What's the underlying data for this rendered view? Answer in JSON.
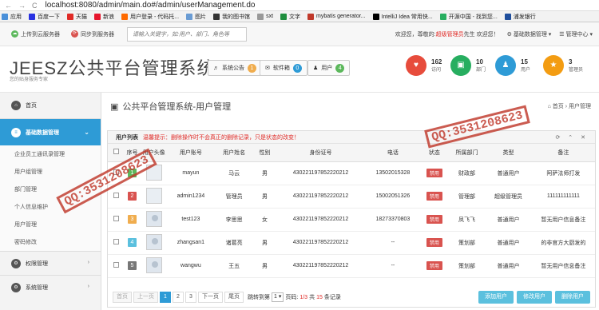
{
  "browser": {
    "url": "localhost:8080/admin/main.do#/admin/userManagement.do",
    "back": "←",
    "forward": "→",
    "reload": "C"
  },
  "bookmarks": [
    "应用",
    "百度一下",
    "天猫",
    "新浪",
    "用户登录 - 代码托...",
    "图片",
    "我的图书馆",
    "sxt",
    "文字",
    "mybatis generator...",
    "IntelliJ Idea 常用快...",
    "开源中国 - 找到您...",
    "浦发银行"
  ],
  "topbar": {
    "upload": "上传到云服务器",
    "sync": "同步到服务器",
    "search_placeholder": "请输入关键字，如:用户、部门、角色等",
    "welcome": "欢迎您，尊敬的:",
    "user": "超级管理员",
    "welcome_tail": "先生 欢迎您！",
    "basic_mgmt": "基础数据管理",
    "mgmt_center": "管理中心"
  },
  "header": {
    "logo": "JEESZ公共平台管理系统",
    "slogan": "您的贴身服务专家",
    "sys_notice": "系统公告",
    "sys_notice_count": "1",
    "msg_box": "软件箱",
    "msg_box_count": "0",
    "users": "用户",
    "users_count": "4"
  },
  "stats": [
    {
      "num": "162",
      "label": "访问",
      "color": "#e74c3c",
      "icon": "♥"
    },
    {
      "num": "10",
      "label": "部门",
      "color": "#27ae60",
      "icon": "▣"
    },
    {
      "num": "15",
      "label": "用户",
      "color": "#2e9bd6",
      "icon": "♟"
    },
    {
      "num": "3",
      "label": "管理员",
      "color": "#f39c12",
      "icon": "★"
    }
  ],
  "sidebar": {
    "home": "首页",
    "active": "基础数据管理",
    "subs": [
      "企业员工通讯录管理",
      "用户组管理",
      "部门管理",
      "个人信息维护",
      "用户管理",
      "密码修改"
    ],
    "sec1": "权限管理",
    "sec2": "系统管理"
  },
  "main": {
    "title": "公共平台管理系统-用户管理",
    "crumb_home": "首页",
    "crumb_current": "用户管理"
  },
  "panel": {
    "title": "用户列表",
    "warning": "温馨提示：删除操作时不会真正的删除记录，只是状态的改变！",
    "actions": "⟳ ⌃ ✕"
  },
  "table": {
    "headers": [
      "",
      "序号",
      "用户头像",
      "用户账号",
      "用户姓名",
      "性别",
      "身份证号",
      "电话",
      "状态",
      "所属部门",
      "类型",
      "备注"
    ],
    "rows": [
      {
        "no": "1",
        "color": "#5cb85c",
        "account": "mayun",
        "name": "马云",
        "sex": "男",
        "id": "430221197852220212",
        "phone": "13502015328",
        "status": "禁用",
        "dept": "财政部",
        "type": "普通用户",
        "note": "阿萨法师打发"
      },
      {
        "no": "2",
        "color": "#d9534f",
        "account": "admin1234",
        "name": "管理员",
        "sex": "男",
        "id": "430221197852220212",
        "phone": "15002051326",
        "status": "禁用",
        "dept": "管理部",
        "type": "超级管理员",
        "note": "111111111111"
      },
      {
        "no": "3",
        "color": "#f0ad4e",
        "account": "test123",
        "name": "李思思",
        "sex": "女",
        "id": "430221197852220212",
        "phone": "18273370803",
        "status": "禁用",
        "dept": "凤飞飞",
        "type": "普通用户",
        "note": "暂无用户信息备注"
      },
      {
        "no": "4",
        "color": "#5bc0de",
        "account": "zhangsan1",
        "name": "诸葛亮",
        "sex": "男",
        "id": "430221197852220212",
        "phone": "--",
        "status": "禁用",
        "dept": "策划部",
        "type": "普通用户",
        "note": "的非官方大厨发的"
      },
      {
        "no": "5",
        "color": "#777777",
        "account": "wangwu",
        "name": "王五",
        "sex": "男",
        "id": "430221197852220212",
        "phone": "--",
        "status": "禁用",
        "dept": "策划部",
        "type": "普通用户",
        "note": "暂无用户信息备注"
      }
    ]
  },
  "pager": {
    "first": "首页",
    "prev": "上一页",
    "pages": [
      "1",
      "2",
      "3"
    ],
    "next": "下一页",
    "last": "尾页",
    "jump": "跳转到第",
    "jump_val": "1",
    "page_label": "页码:",
    "page_cur": "1/3",
    "total_pre": "共",
    "total": "15",
    "total_suf": "条记录"
  },
  "buttons": {
    "add": "添加用户",
    "edit": "修改用户",
    "del": "删除用户"
  },
  "watermark": "QQ:3531208623"
}
